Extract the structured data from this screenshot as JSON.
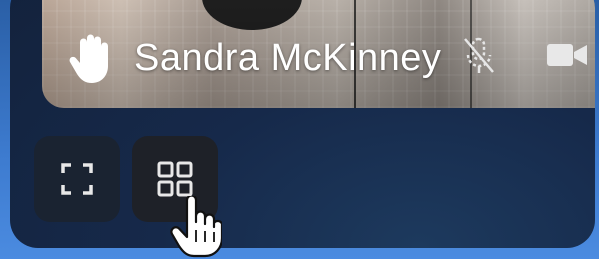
{
  "participant": {
    "name": "Sandra McKinney",
    "hand_raised": true,
    "mic_muted": true,
    "camera_on": true
  },
  "controls": {
    "fullscreen_icon": "fullscreen-icon",
    "grid_icon": "grid-view-icon"
  },
  "cursor": "hand-pointer-cursor",
  "colors": {
    "panel": "#16294a",
    "button_bg": "#1e2128",
    "icon": "#e8e8e8",
    "backdrop_accent": "#3d7bcf"
  }
}
